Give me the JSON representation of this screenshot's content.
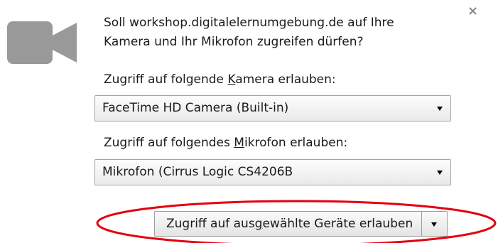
{
  "prompt": {
    "line1": "Soll workshop.digitalelernumgebung.de auf Ihre",
    "line2": "Kamera und Ihr Mikrofon zugreifen dürfen?"
  },
  "camera_section": {
    "label_before": "Zugriff auf folgende ",
    "label_accel": "K",
    "label_after": "amera erlauben:",
    "selected": "FaceTime HD Camera (Built-in)"
  },
  "microphone_section": {
    "label_before": "Zugriff auf folgendes ",
    "label_accel": "M",
    "label_after": "ikrofon erlauben:",
    "selected": "Mikrofon (Cirrus Logic CS4206B"
  },
  "allow_button": {
    "before": "Zugriff auf aus",
    "accel": "g",
    "after": "ewählte Geräte erlauben"
  },
  "icons": {
    "camera": "video-camera-icon",
    "close": "close-icon",
    "dropdown": "chevron-down-icon"
  },
  "colors": {
    "camera_icon": "#999999",
    "close_icon": "#8a8a8a",
    "highlight": "#e3000f"
  }
}
